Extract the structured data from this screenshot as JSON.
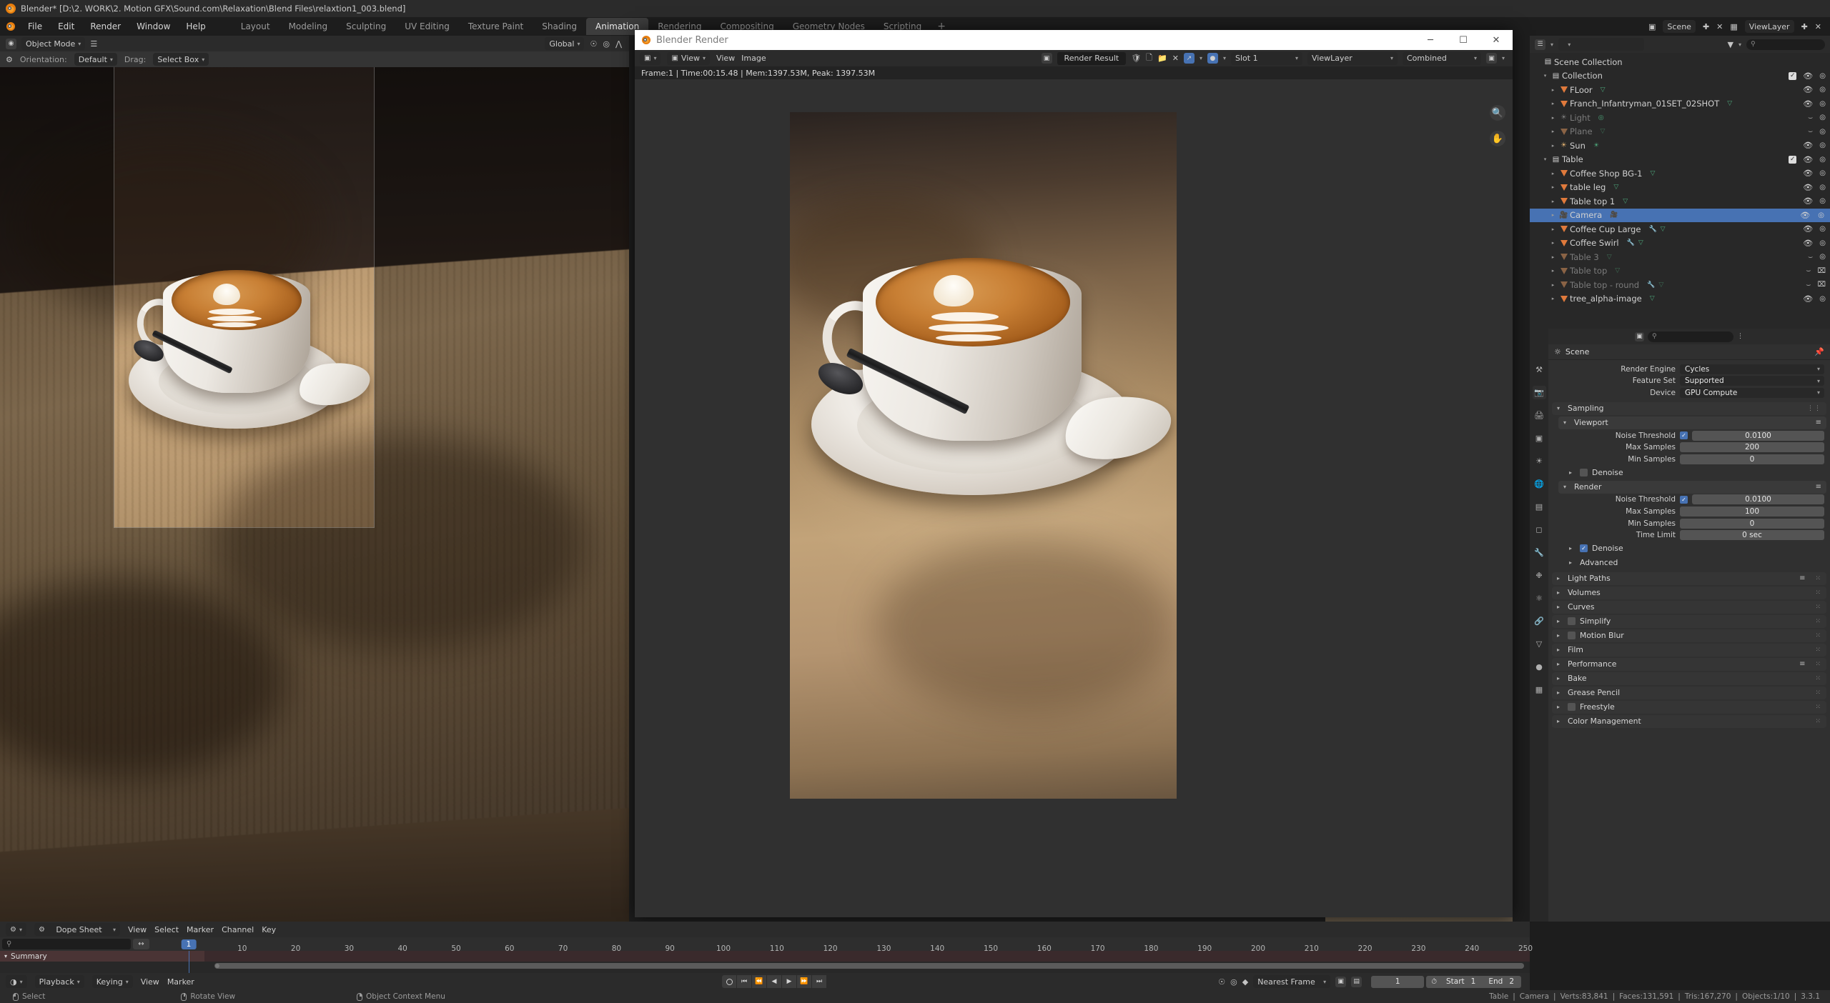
{
  "window": {
    "title": "Blender* [D:\\2. WORK\\2. Motion GFX\\Sound.com\\Relaxation\\Blend Files\\relaxtion1_003.blend]",
    "logo_icon": "blender-logo-icon"
  },
  "topbar": {
    "menus": [
      "File",
      "Edit",
      "Render",
      "Window",
      "Help"
    ],
    "workspaces": [
      {
        "label": "Layout",
        "active": false
      },
      {
        "label": "Modeling",
        "active": false
      },
      {
        "label": "Sculpting",
        "active": false
      },
      {
        "label": "UV Editing",
        "active": false
      },
      {
        "label": "Texture Paint",
        "active": false
      },
      {
        "label": "Shading",
        "active": false
      },
      {
        "label": "Animation",
        "active": true
      },
      {
        "label": "Rendering",
        "active": false
      },
      {
        "label": "Compositing",
        "active": false
      },
      {
        "label": "Geometry Nodes",
        "active": false
      },
      {
        "label": "Scripting",
        "active": false
      }
    ],
    "add_workspace_label": "+",
    "scene_name": "Scene",
    "viewlayer_name": "ViewLayer"
  },
  "viewport": {
    "mode": "Object Mode",
    "orientation_label": "Orientation:",
    "orientation_value": "Default",
    "drag_label": "Drag:",
    "drag_value": "Select Box",
    "transform_orientation": "Global"
  },
  "render_window": {
    "title": "Blender Render",
    "window_buttons": {
      "minimize": "─",
      "maximize": "☐",
      "close": "✕"
    },
    "menus": [
      "View",
      "Image"
    ],
    "view_button": "View",
    "image_name": "Render Result",
    "slot": "Slot 1",
    "view_layer": "ViewLayer",
    "pass": "Combined",
    "stats": "Frame:1 | Time:00:15.48 | Mem:1397.53M, Peak: 1397.53M",
    "tools": [
      "zoom-icon",
      "hand-icon"
    ]
  },
  "outliner": {
    "search_placeholder": "",
    "rows": [
      {
        "name": "Scene Collection",
        "icon": "scene-collection-icon",
        "indent": 0,
        "arrow": "",
        "muted": false,
        "selected": false,
        "checkbox": false,
        "eye": "",
        "camera": "",
        "extras": []
      },
      {
        "name": "Collection",
        "icon": "collection-icon",
        "indent": 1,
        "arrow": "down",
        "muted": false,
        "selected": false,
        "checkbox": true,
        "eye": "on",
        "camera": "on",
        "extras": []
      },
      {
        "name": "FLoor",
        "icon": "mesh-icon",
        "indent": 2,
        "arrow": "right",
        "muted": false,
        "selected": false,
        "checkbox": false,
        "eye": "on",
        "camera": "on",
        "extras": [
          "mesh-data-icon"
        ]
      },
      {
        "name": "Franch_Infantryman_01SET_02SHOT",
        "icon": "mesh-icon",
        "indent": 2,
        "arrow": "right",
        "muted": false,
        "selected": false,
        "checkbox": false,
        "eye": "on",
        "camera": "on",
        "extras": [
          "mesh-data-icon"
        ]
      },
      {
        "name": "Light",
        "icon": "light-icon",
        "indent": 2,
        "arrow": "right",
        "muted": true,
        "selected": false,
        "checkbox": false,
        "eye": "off",
        "camera": "on",
        "extras": [
          "light-data-icon"
        ]
      },
      {
        "name": "Plane",
        "icon": "mesh-icon",
        "indent": 2,
        "arrow": "right",
        "muted": true,
        "selected": false,
        "checkbox": false,
        "eye": "off",
        "camera": "on",
        "extras": [
          "mesh-data-icon"
        ]
      },
      {
        "name": "Sun",
        "icon": "light-icon",
        "indent": 2,
        "arrow": "right",
        "muted": false,
        "selected": false,
        "checkbox": false,
        "eye": "on",
        "camera": "on",
        "extras": [
          "sun-data-icon"
        ]
      },
      {
        "name": "Table",
        "icon": "collection-icon",
        "indent": 1,
        "arrow": "down",
        "muted": false,
        "selected": false,
        "checkbox": true,
        "eye": "on",
        "camera": "on",
        "extras": []
      },
      {
        "name": "Coffee Shop BG-1",
        "icon": "mesh-icon",
        "indent": 2,
        "arrow": "right",
        "muted": false,
        "selected": false,
        "checkbox": false,
        "eye": "on",
        "camera": "on",
        "extras": [
          "mesh-data-icon"
        ]
      },
      {
        "name": "table leg",
        "icon": "mesh-icon",
        "indent": 2,
        "arrow": "right",
        "muted": false,
        "selected": false,
        "checkbox": false,
        "eye": "on",
        "camera": "on",
        "extras": [
          "mesh-data-icon"
        ]
      },
      {
        "name": "Table top 1",
        "icon": "mesh-icon",
        "indent": 2,
        "arrow": "right",
        "muted": false,
        "selected": false,
        "checkbox": false,
        "eye": "on",
        "camera": "on",
        "extras": [
          "mesh-data-icon"
        ]
      },
      {
        "name": "Camera",
        "icon": "camera-object-icon",
        "indent": 2,
        "arrow": "right",
        "muted": false,
        "selected": true,
        "checkbox": false,
        "eye": "on",
        "camera": "on-highlight",
        "extras": [
          "camera-data-icon"
        ]
      },
      {
        "name": "Coffee Cup Large",
        "icon": "mesh-icon",
        "indent": 2,
        "arrow": "right",
        "muted": false,
        "selected": false,
        "checkbox": false,
        "eye": "on",
        "camera": "on",
        "extras": [
          "modifier-icon",
          "mesh-data-icon"
        ]
      },
      {
        "name": "Coffee Swirl",
        "icon": "mesh-icon",
        "indent": 2,
        "arrow": "right",
        "muted": false,
        "selected": false,
        "checkbox": false,
        "eye": "on",
        "camera": "on",
        "extras": [
          "modifier-icon",
          "mesh-data-icon"
        ]
      },
      {
        "name": "Table 3",
        "icon": "mesh-icon",
        "indent": 2,
        "arrow": "right",
        "muted": true,
        "selected": false,
        "checkbox": false,
        "eye": "off",
        "camera": "on",
        "extras": [
          "mesh-data-icon"
        ]
      },
      {
        "name": "Table top",
        "icon": "mesh-icon",
        "indent": 2,
        "arrow": "right",
        "muted": true,
        "selected": false,
        "checkbox": false,
        "eye": "off",
        "camera": "off",
        "extras": [
          "mesh-data-icon"
        ]
      },
      {
        "name": "Table top - round",
        "icon": "mesh-icon",
        "indent": 2,
        "arrow": "right",
        "muted": true,
        "selected": false,
        "checkbox": false,
        "eye": "off",
        "camera": "off",
        "extras": [
          "modifier-icon",
          "mesh-data-icon"
        ]
      },
      {
        "name": "tree_alpha-image",
        "icon": "mesh-icon",
        "indent": 2,
        "arrow": "right",
        "muted": false,
        "selected": false,
        "checkbox": false,
        "eye": "on",
        "camera": "on",
        "extras": [
          "mesh-data-icon"
        ]
      }
    ]
  },
  "properties": {
    "breadcrumb": "Scene",
    "breadcrumb_icon": "scene-icon",
    "pin_icon": "pin-icon",
    "fields": [
      {
        "label": "Render Engine",
        "value": "Cycles"
      },
      {
        "label": "Feature Set",
        "value": "Supported"
      },
      {
        "label": "Device",
        "value": "GPU Compute"
      }
    ],
    "sampling": {
      "title": "Sampling",
      "viewport": {
        "title": "Viewport",
        "noise_threshold_label": "Noise Threshold",
        "noise_threshold_value": "0.0100",
        "noise_threshold_checked": true,
        "max_samples_label": "Max Samples",
        "max_samples_value": "200",
        "min_samples_label": "Min Samples",
        "min_samples_value": "0",
        "denoise_label": "Denoise",
        "denoise_checked": false
      },
      "render": {
        "title": "Render",
        "noise_threshold_label": "Noise Threshold",
        "noise_threshold_value": "0.0100",
        "noise_threshold_checked": true,
        "max_samples_label": "Max Samples",
        "max_samples_value": "100",
        "min_samples_label": "Min Samples",
        "min_samples_value": "0",
        "time_limit_label": "Time Limit",
        "time_limit_value": "0 sec",
        "denoise_label": "Denoise",
        "denoise_checked": true,
        "advanced_label": "Advanced"
      }
    },
    "panels": [
      {
        "label": "Light Paths",
        "checkbox": null,
        "list_icon": true
      },
      {
        "label": "Volumes",
        "checkbox": null,
        "list_icon": false
      },
      {
        "label": "Curves",
        "checkbox": null,
        "list_icon": false
      },
      {
        "label": "Simplify",
        "checkbox": false,
        "list_icon": false
      },
      {
        "label": "Motion Blur",
        "checkbox": false,
        "list_icon": false
      },
      {
        "label": "Film",
        "checkbox": null,
        "list_icon": false
      },
      {
        "label": "Performance",
        "checkbox": null,
        "list_icon": true
      },
      {
        "label": "Bake",
        "checkbox": null,
        "list_icon": false
      },
      {
        "label": "Grease Pencil",
        "checkbox": null,
        "list_icon": false
      },
      {
        "label": "Freestyle",
        "checkbox": false,
        "list_icon": false
      },
      {
        "label": "Color Management",
        "checkbox": null,
        "list_icon": false
      }
    ],
    "tabs": [
      "tool-icon",
      "render-icon",
      "output-icon",
      "viewlayer-icon",
      "scene-icon",
      "world-icon",
      "collection-icon",
      "object-icon",
      "modifier-icon",
      "particles-icon",
      "physics-icon",
      "constraint-icon",
      "data-icon",
      "material-icon",
      "texture-icon"
    ]
  },
  "dopesheet": {
    "editor_name": "Dope Sheet",
    "mode_icon": "dopesheet-icon",
    "menus": [
      "View",
      "Select",
      "Marker",
      "Channel",
      "Key"
    ],
    "search_icon": "search-icon",
    "summary_label": "Summary",
    "current_frame": "1",
    "ticks": [
      "10",
      "20",
      "30",
      "40",
      "50",
      "60",
      "70",
      "80",
      "90",
      "100",
      "110",
      "120",
      "130",
      "140",
      "150",
      "160",
      "170",
      "180",
      "190",
      "200",
      "210",
      "220",
      "230",
      "240",
      "250"
    ],
    "tick_values": [
      10,
      20,
      30,
      40,
      50,
      60,
      70,
      80,
      90,
      100,
      110,
      120,
      130,
      140,
      150,
      160,
      170,
      180,
      190,
      200,
      210,
      220,
      230,
      240,
      250
    ]
  },
  "timeline": {
    "menus": [
      "Playback",
      "Keying",
      "View",
      "Marker"
    ],
    "snap_label": "Nearest Frame",
    "frame_value": "1",
    "start_label": "Start",
    "start_value": "1",
    "end_label": "End",
    "end_value": "2",
    "transport": [
      "jump-start-icon",
      "prev-keyframe-icon",
      "play-reverse-icon",
      "play-icon",
      "next-keyframe-icon",
      "jump-end-icon"
    ]
  },
  "statusbar": {
    "hints": [
      {
        "mouse": "left",
        "label": "Select"
      },
      {
        "mouse": "middle",
        "label": "Rotate View"
      },
      {
        "mouse": "right",
        "label": "Object Context Menu"
      }
    ],
    "scene_stats": [
      "Table",
      "Camera",
      "Verts:83,841",
      "Faces:131,591",
      "Tris:167,270",
      "Objects:1/10",
      "3.3.1"
    ]
  },
  "colors": {
    "accent_blue": "#4772b3",
    "orange": "#e87d0d",
    "mesh_orange": "#e07a3c",
    "data_green": "#4ca579",
    "bg_dark": "#1d1d1d",
    "panel": "#303030",
    "header": "#2b2b2b"
  }
}
